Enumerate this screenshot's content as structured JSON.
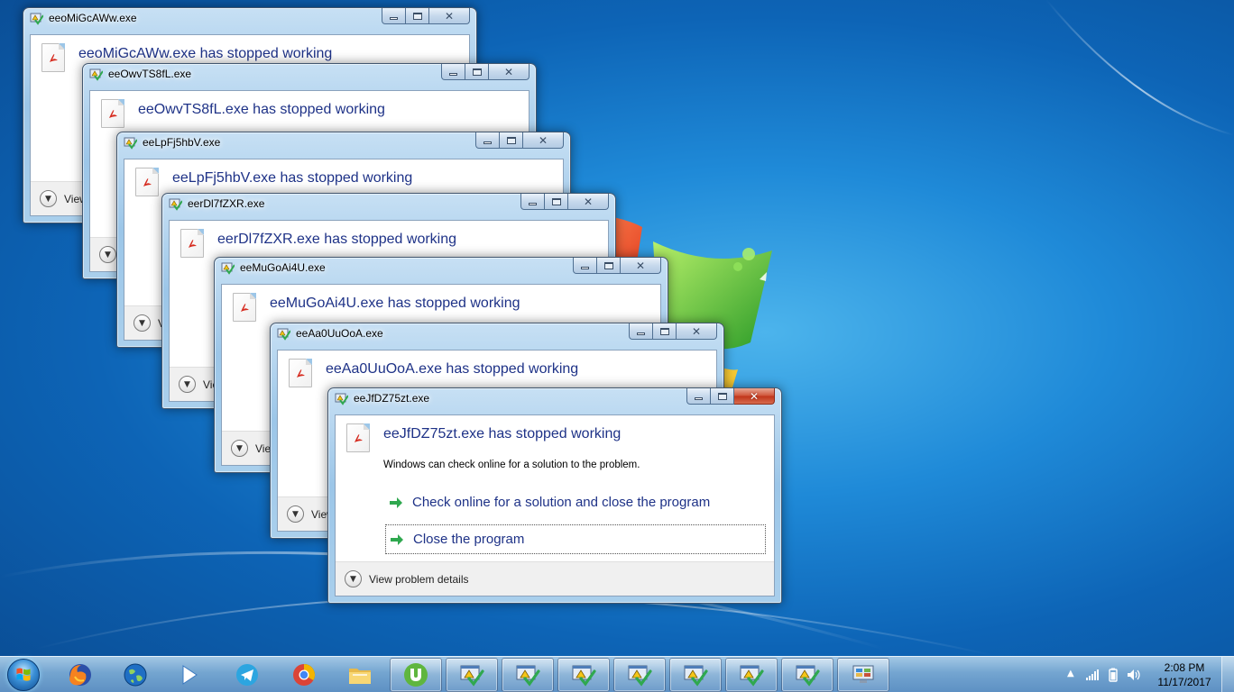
{
  "dialogs": [
    {
      "title": "eeoMiGcAWw.exe",
      "headline": "eeoMiGcAWw.exe has stopped working"
    },
    {
      "title": "eeOwvTS8fL.exe",
      "headline": "eeOwvTS8fL.exe has stopped working"
    },
    {
      "title": "eeLpFj5hbV.exe",
      "headline": "eeLpFj5hbV.exe has stopped working"
    },
    {
      "title": "eerDl7fZXR.exe",
      "headline": "eerDl7fZXR.exe has stopped working"
    },
    {
      "title": "eeMuGoAi4U.exe",
      "headline": "eeMuGoAi4U.exe has stopped working"
    },
    {
      "title": "eeAa0UuOoA.exe",
      "headline": "eeAa0UuOoA.exe has stopped working"
    },
    {
      "title": "eeJfDZ75zt.exe",
      "headline": "eeJfDZ75zt.exe has stopped working",
      "subtext": "Windows can check online for a solution to the problem.",
      "option_check_online": "Check online for a solution and close the program",
      "option_close": "Close the program",
      "details_label": "View problem details"
    }
  ],
  "partial_details_label": "View",
  "taskbar": {
    "pinned": [
      {
        "name": "firefox",
        "icon": "firefox-icon"
      },
      {
        "name": "internet",
        "icon": "globe-icon"
      },
      {
        "name": "media player",
        "icon": "play-icon"
      },
      {
        "name": "telegram",
        "icon": "telegram-icon"
      },
      {
        "name": "chrome",
        "icon": "chrome-icon"
      },
      {
        "name": "explorer",
        "icon": "folder-icon"
      },
      {
        "name": "utorrent",
        "icon": "utorrent-icon"
      }
    ],
    "open_windows": 7
  },
  "clock": {
    "time": "2:08 PM",
    "date": "11/17/2017"
  },
  "colors": {
    "headline": "#1e3287",
    "desktop_blue": "#1f8ad8",
    "arrow_green": "#2fa84f",
    "close_red": "#c0351a"
  }
}
